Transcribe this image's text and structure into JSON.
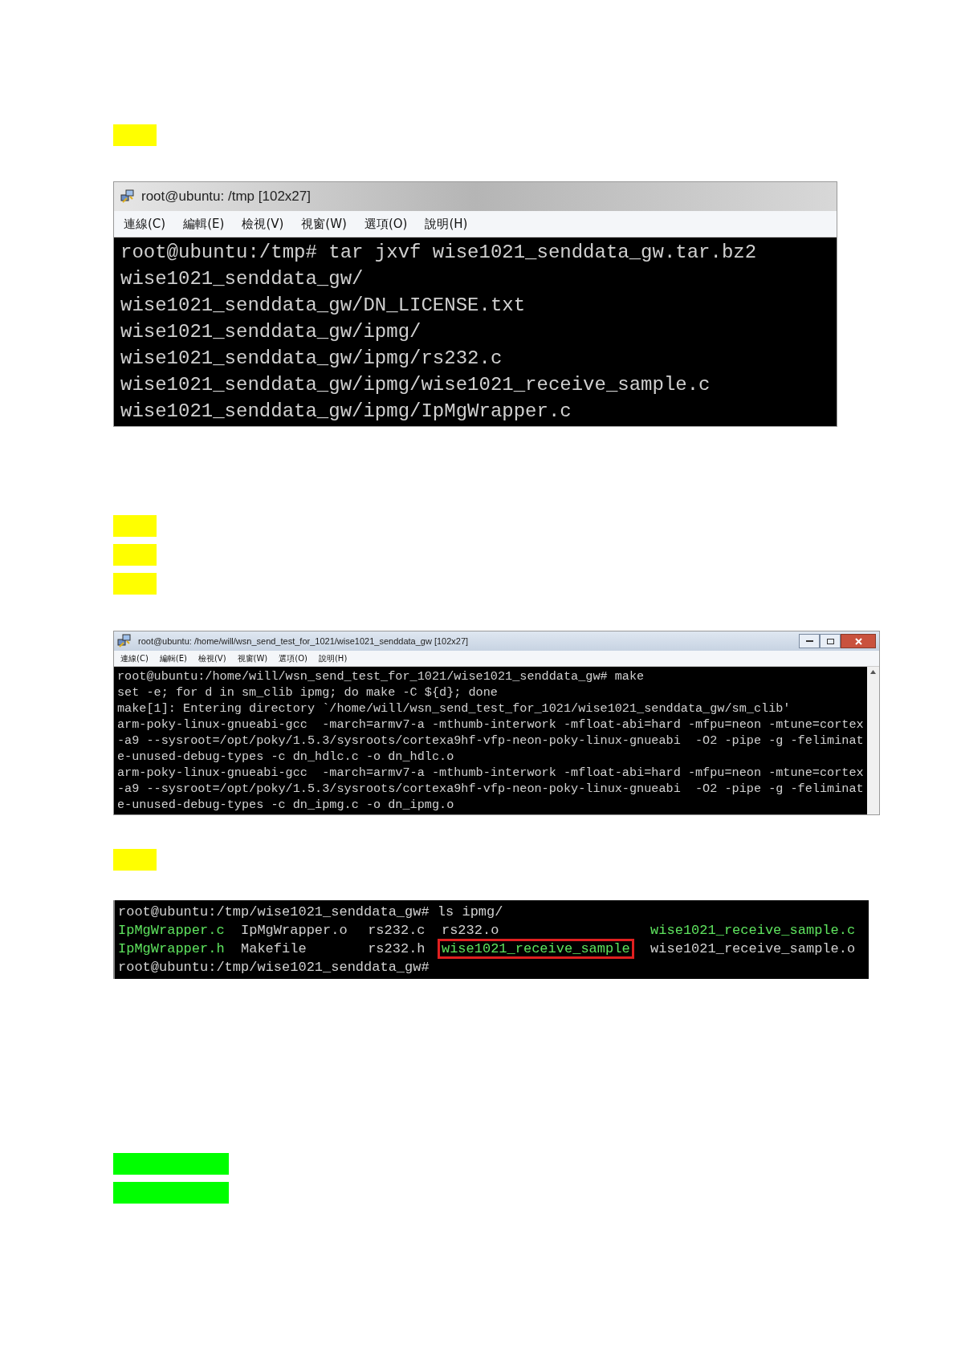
{
  "sections": [
    {
      "kind": "highlight",
      "color": "#ffff00"
    },
    {
      "kind": "terminal",
      "title": "root@ubuntu: /tmp [102x27]",
      "controls": false,
      "scrollbar": false,
      "menu": [
        "連線(C)",
        "編輯(E)",
        "檢視(V)",
        "視窗(W)",
        "選項(O)",
        "說明(H)"
      ],
      "lines": [
        "root@ubuntu:/tmp# tar jxvf wise1021_senddata_gw.tar.bz2",
        "wise1021_senddata_gw/",
        "wise1021_senddata_gw/DN_LICENSE.txt",
        "wise1021_senddata_gw/ipmg/",
        "wise1021_senddata_gw/ipmg/rs232.c",
        "wise1021_senddata_gw/ipmg/wise1021_receive_sample.c",
        "wise1021_senddata_gw/ipmg/IpMgWrapper.c"
      ]
    },
    {
      "kind": "spacer"
    },
    {
      "kind": "highlight",
      "color": "#ffff00"
    },
    {
      "kind": "highlight",
      "color": "#ffff00"
    },
    {
      "kind": "highlight",
      "color": "#ffff00"
    },
    {
      "kind": "compact_terminal",
      "title": "root@ubuntu: /home/will/wsn_send_test_for_1021/wise1021_senddata_gw [102x27]",
      "controls": true,
      "scrollbar": true,
      "menu": [
        "連線(C)",
        "編輯(E)",
        "檢視(V)",
        "視窗(W)",
        "選項(O)",
        "說明(H)"
      ],
      "lines": [
        "root@ubuntu:/home/will/wsn_send_test_for_1021/wise1021_senddata_gw# make",
        "set -e; for d in sm_clib ipmg; do make -C ${d}; done",
        "make[1]: Entering directory `/home/will/wsn_send_test_for_1021/wise1021_senddata_gw/sm_clib'",
        "arm-poky-linux-gnueabi-gcc  -march=armv7-a -mthumb-interwork -mfloat-abi=hard -mfpu=neon -mtune=cortex",
        "-a9 --sysroot=/opt/poky/1.5.3/sysroots/cortexa9hf-vfp-neon-poky-linux-gnueabi  -O2 -pipe -g -feliminat",
        "e-unused-debug-types -c dn_hdlc.c -o dn_hdlc.o",
        "arm-poky-linux-gnueabi-gcc  -march=armv7-a -mthumb-interwork -mfloat-abi=hard -mfpu=neon -mtune=cortex",
        "-a9 --sysroot=/opt/poky/1.5.3/sysroots/cortexa9hf-vfp-neon-poky-linux-gnueabi  -O2 -pipe -g -feliminat",
        "e-unused-debug-types -c dn_ipmg.c -o dn_ipmg.o"
      ]
    },
    {
      "kind": "highlight",
      "color": "#ffff00"
    },
    {
      "kind": "listing",
      "prompt": "root@ubuntu:/tmp/wise1021_senddata_gw# ls ipmg/",
      "rows": [
        [
          {
            "text": "IpMgWrapper.c",
            "kind": "source"
          },
          {
            "text": "IpMgWrapper.o",
            "kind": "plain"
          },
          {
            "text": "rs232.c",
            "kind": "plain"
          },
          {
            "text": "rs232.o",
            "kind": "plain"
          },
          {
            "text": "wise1021_receive_sample.c",
            "kind": "source"
          }
        ],
        [
          {
            "text": "IpMgWrapper.h",
            "kind": "source"
          },
          {
            "text": "Makefile",
            "kind": "plain"
          },
          {
            "text": "rs232.h",
            "kind": "plain"
          },
          {
            "text": "wise1021_receive_sample",
            "kind": "boxed"
          },
          {
            "text": "wise1021_receive_sample.o",
            "kind": "plain"
          }
        ]
      ],
      "end_prompt": "root@ubuntu:/tmp/wise1021_senddata_gw#"
    },
    {
      "kind": "bigspacer"
    },
    {
      "kind": "highlight",
      "color": "#00ff00"
    },
    {
      "kind": "highlight",
      "color": "#00ff00"
    }
  ]
}
